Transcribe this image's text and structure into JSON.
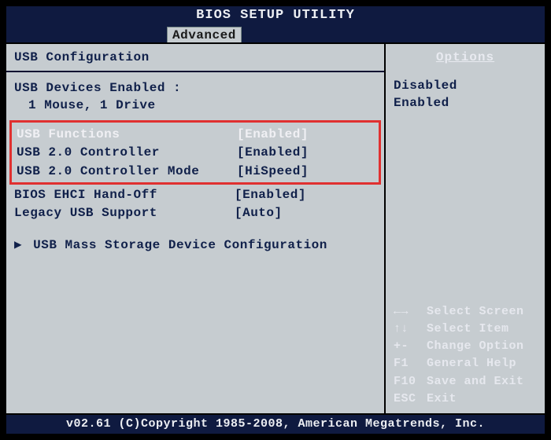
{
  "title": "BIOS SETUP UTILITY",
  "active_tab": "Advanced",
  "section": "USB Configuration",
  "status": {
    "heading": "USB Devices Enabled :",
    "line": "1 Mouse, 1 Drive"
  },
  "settings": [
    {
      "label": "USB Functions",
      "value": "[Enabled]",
      "selected": true,
      "highlighted": true
    },
    {
      "label": "USB 2.0 Controller",
      "value": "[Enabled]",
      "selected": false,
      "highlighted": true
    },
    {
      "label": "USB 2.0 Controller Mode",
      "value": "[HiSpeed]",
      "selected": false,
      "highlighted": true
    },
    {
      "label": "BIOS EHCI Hand-Off",
      "value": "[Enabled]",
      "selected": false,
      "highlighted": false
    },
    {
      "label": "Legacy USB Support",
      "value": "[Auto]",
      "selected": false,
      "highlighted": false
    }
  ],
  "submenu": "USB Mass Storage Device Configuration",
  "right": {
    "header": "Options",
    "values": [
      "Disabled",
      "Enabled"
    ]
  },
  "help": [
    {
      "key": "←→",
      "desc": "Select Screen"
    },
    {
      "key": "↑↓",
      "desc": "Select Item"
    },
    {
      "key": "+-",
      "desc": "Change Option"
    },
    {
      "key": "F1",
      "desc": "General Help"
    },
    {
      "key": "F10",
      "desc": "Save and Exit"
    },
    {
      "key": "ESC",
      "desc": "Exit"
    }
  ],
  "footer": "v02.61 (C)Copyright 1985-2008, American Megatrends, Inc."
}
